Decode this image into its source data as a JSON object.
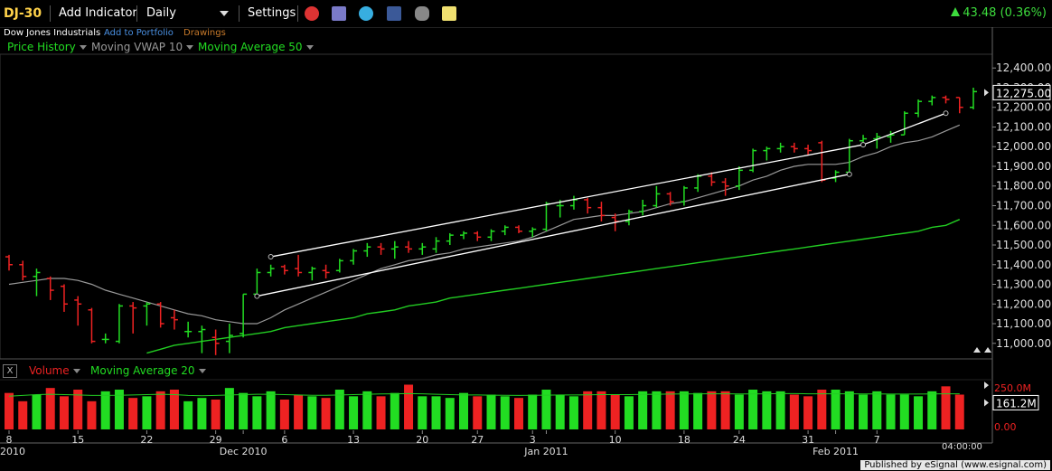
{
  "toolbar": {
    "ticker": "DJ-30",
    "add_indicator": "Add Indicator",
    "interval": "Daily",
    "settings": "Settings",
    "change": "43.48 (0.36%)"
  },
  "subbar": {
    "name": "Dow Jones Industrials",
    "add_to_portfolio": "Add to Portfolio",
    "drawings": "Drawings"
  },
  "legend": {
    "price_history": "Price History",
    "vwap": "Moving VWAP 10",
    "ma50": "Moving Average 50"
  },
  "volume_legend": {
    "close": "X",
    "volume": "Volume",
    "ma20": "Moving Average 20"
  },
  "colors": {
    "up": "#22dd22",
    "down": "#ee2222",
    "ma50": "#22cc22",
    "vwap": "#999999",
    "ticker": "#ffd24a"
  },
  "footer": "Published by eSignal (www.esignal.com)",
  "chart_data": {
    "type": "ohlc",
    "price_axis": {
      "ticks": [
        "12,400.00",
        "12,300.00",
        "12,200.00",
        "12,100.00",
        "12,000.00",
        "11,900.00",
        "11,800.00",
        "11,700.00",
        "11,600.00",
        "11,500.00",
        "11,400.00",
        "11,300.00",
        "11,200.00",
        "11,100.00",
        "11,000.00"
      ],
      "current_label": "12,275.00",
      "range": [
        10930,
        12470
      ]
    },
    "volume_axis": {
      "ticks": [
        "250.0M",
        "0.00"
      ],
      "current_label": "161.2M",
      "range": [
        0,
        300
      ]
    },
    "x_labels": [
      {
        "label": "8",
        "bar": 0
      },
      {
        "label": "15",
        "bar": 5
      },
      {
        "label": "22",
        "bar": 10
      },
      {
        "label": "29",
        "bar": 15
      },
      {
        "label": "Dec 2010",
        "bar": 17
      },
      {
        "label": "6",
        "bar": 20
      },
      {
        "label": "13",
        "bar": 25
      },
      {
        "label": "20",
        "bar": 30
      },
      {
        "label": "27",
        "bar": 34
      },
      {
        "label": "3",
        "bar": 38
      },
      {
        "label": "Jan 2011",
        "bar": 39
      },
      {
        "label": "10",
        "bar": 44
      },
      {
        "label": "18",
        "bar": 49
      },
      {
        "label": "24",
        "bar": 53
      },
      {
        "label": "31",
        "bar": 58
      },
      {
        "label": "Feb 2011",
        "bar": 60
      },
      {
        "label": "7",
        "bar": 63
      },
      {
        "label": "2010",
        "bar": 0
      }
    ],
    "time_label": "04:00:00",
    "bars": [
      {
        "o": 11440,
        "h": 11450,
        "l": 11370,
        "c": 11400
      },
      {
        "o": 11400,
        "h": 11420,
        "l": 11320,
        "c": 11340
      },
      {
        "o": 11340,
        "h": 11380,
        "l": 11240,
        "c": 11360
      },
      {
        "o": 11330,
        "h": 11340,
        "l": 11220,
        "c": 11270
      },
      {
        "o": 11290,
        "h": 11300,
        "l": 11160,
        "c": 11200
      },
      {
        "o": 11220,
        "h": 11240,
        "l": 11090,
        "c": 11200
      },
      {
        "o": 11170,
        "h": 11180,
        "l": 11000,
        "c": 11010
      },
      {
        "o": 11020,
        "h": 11050,
        "l": 11000,
        "c": 11020
      },
      {
        "o": 11010,
        "h": 11200,
        "l": 11000,
        "c": 11190
      },
      {
        "o": 11190,
        "h": 11210,
        "l": 11050,
        "c": 11180
      },
      {
        "o": 11190,
        "h": 11210,
        "l": 11090,
        "c": 11200
      },
      {
        "o": 11200,
        "h": 11210,
        "l": 11080,
        "c": 11100
      },
      {
        "o": 11130,
        "h": 11170,
        "l": 11070,
        "c": 11120
      },
      {
        "o": 11060,
        "h": 11110,
        "l": 11030,
        "c": 11060
      },
      {
        "o": 11060,
        "h": 11090,
        "l": 10950,
        "c": 11070
      },
      {
        "o": 11030,
        "h": 11070,
        "l": 10940,
        "c": 11000
      },
      {
        "o": 11010,
        "h": 11100,
        "l": 10950,
        "c": 11040
      },
      {
        "o": 11050,
        "h": 11250,
        "l": 11030,
        "c": 11250
      },
      {
        "o": 11250,
        "h": 11380,
        "l": 11240,
        "c": 11360
      },
      {
        "o": 11360,
        "h": 11400,
        "l": 11340,
        "c": 11380
      },
      {
        "o": 11390,
        "h": 11400,
        "l": 11350,
        "c": 11370
      },
      {
        "o": 11380,
        "h": 11450,
        "l": 11340,
        "c": 11360
      },
      {
        "o": 11360,
        "h": 11390,
        "l": 11320,
        "c": 11380
      },
      {
        "o": 11370,
        "h": 11400,
        "l": 11330,
        "c": 11360
      },
      {
        "o": 11370,
        "h": 11430,
        "l": 11360,
        "c": 11420
      },
      {
        "o": 11420,
        "h": 11480,
        "l": 11400,
        "c": 11470
      },
      {
        "o": 11470,
        "h": 11510,
        "l": 11440,
        "c": 11490
      },
      {
        "o": 11490,
        "h": 11510,
        "l": 11450,
        "c": 11480
      },
      {
        "o": 11480,
        "h": 11520,
        "l": 11430,
        "c": 11490
      },
      {
        "o": 11490,
        "h": 11520,
        "l": 11460,
        "c": 11480
      },
      {
        "o": 11480,
        "h": 11510,
        "l": 11450,
        "c": 11490
      },
      {
        "o": 11480,
        "h": 11540,
        "l": 11460,
        "c": 11520
      },
      {
        "o": 11520,
        "h": 11560,
        "l": 11500,
        "c": 11550
      },
      {
        "o": 11550,
        "h": 11570,
        "l": 11530,
        "c": 11560
      },
      {
        "o": 11560,
        "h": 11570,
        "l": 11520,
        "c": 11540
      },
      {
        "o": 11540,
        "h": 11580,
        "l": 11520,
        "c": 11570
      },
      {
        "o": 11570,
        "h": 11600,
        "l": 11550,
        "c": 11590
      },
      {
        "o": 11590,
        "h": 11600,
        "l": 11560,
        "c": 11570
      },
      {
        "o": 11570,
        "h": 11590,
        "l": 11540,
        "c": 11580
      },
      {
        "o": 11580,
        "h": 11720,
        "l": 11570,
        "c": 11710
      },
      {
        "o": 11700,
        "h": 11730,
        "l": 11640,
        "c": 11700
      },
      {
        "o": 11700,
        "h": 11750,
        "l": 11680,
        "c": 11730
      },
      {
        "o": 11730,
        "h": 11740,
        "l": 11660,
        "c": 11690
      },
      {
        "o": 11690,
        "h": 11720,
        "l": 11620,
        "c": 11650
      },
      {
        "o": 11640,
        "h": 11660,
        "l": 11570,
        "c": 11620
      },
      {
        "o": 11620,
        "h": 11680,
        "l": 11600,
        "c": 11670
      },
      {
        "o": 11670,
        "h": 11730,
        "l": 11650,
        "c": 11700
      },
      {
        "o": 11700,
        "h": 11800,
        "l": 11690,
        "c": 11760
      },
      {
        "o": 11760,
        "h": 11770,
        "l": 11700,
        "c": 11720
      },
      {
        "o": 11720,
        "h": 11800,
        "l": 11700,
        "c": 11790
      },
      {
        "o": 11790,
        "h": 11860,
        "l": 11770,
        "c": 11850
      },
      {
        "o": 11850,
        "h": 11870,
        "l": 11800,
        "c": 11820
      },
      {
        "o": 11820,
        "h": 11840,
        "l": 11750,
        "c": 11800
      },
      {
        "o": 11800,
        "h": 11900,
        "l": 11780,
        "c": 11880
      },
      {
        "o": 11880,
        "h": 11990,
        "l": 11870,
        "c": 11980
      },
      {
        "o": 11980,
        "h": 12000,
        "l": 11930,
        "c": 11990
      },
      {
        "o": 11990,
        "h": 12020,
        "l": 11970,
        "c": 12000
      },
      {
        "o": 12000,
        "h": 12020,
        "l": 11970,
        "c": 11990
      },
      {
        "o": 11990,
        "h": 12010,
        "l": 11960,
        "c": 11980
      },
      {
        "o": 12020,
        "h": 12030,
        "l": 11820,
        "c": 11830
      },
      {
        "o": 11840,
        "h": 11880,
        "l": 11820,
        "c": 11870
      },
      {
        "o": 11870,
        "h": 12040,
        "l": 11860,
        "c": 12030
      },
      {
        "o": 12030,
        "h": 12060,
        "l": 12000,
        "c": 12040
      },
      {
        "o": 12040,
        "h": 12070,
        "l": 11990,
        "c": 12050
      },
      {
        "o": 12050,
        "h": 12080,
        "l": 12020,
        "c": 12060
      },
      {
        "o": 12060,
        "h": 12180,
        "l": 12060,
        "c": 12170
      },
      {
        "o": 12170,
        "h": 12240,
        "l": 12150,
        "c": 12230
      },
      {
        "o": 12230,
        "h": 12260,
        "l": 12210,
        "c": 12250
      },
      {
        "o": 12250,
        "h": 12260,
        "l": 12220,
        "c": 12240
      },
      {
        "o": 12250,
        "h": 12250,
        "l": 12170,
        "c": 12200
      },
      {
        "o": 12200,
        "h": 12300,
        "l": 12190,
        "c": 12280
      }
    ],
    "vwap10": [
      11300,
      11310,
      11320,
      11330,
      11330,
      11320,
      11300,
      11270,
      11250,
      11230,
      11210,
      11190,
      11170,
      11150,
      11140,
      11120,
      11110,
      11100,
      11100,
      11130,
      11170,
      11200,
      11230,
      11260,
      11290,
      11320,
      11350,
      11380,
      11400,
      11420,
      11430,
      11450,
      11460,
      11480,
      11490,
      11500,
      11510,
      11520,
      11540,
      11570,
      11600,
      11630,
      11640,
      11650,
      11650,
      11660,
      11670,
      11690,
      11710,
      11720,
      11740,
      11760,
      11780,
      11800,
      11830,
      11850,
      11880,
      11900,
      11910,
      11910,
      11910,
      11920,
      11950,
      11970,
      12000,
      12020,
      12030,
      12050,
      12080,
      12110
    ],
    "ma50": [
      null,
      null,
      null,
      null,
      null,
      null,
      null,
      null,
      null,
      null,
      10950,
      10970,
      10990,
      11000,
      11010,
      11020,
      11030,
      11040,
      11050,
      11060,
      11080,
      11090,
      11100,
      11110,
      11120,
      11130,
      11150,
      11160,
      11170,
      11190,
      11200,
      11210,
      11230,
      11240,
      11250,
      11260,
      11270,
      11280,
      11290,
      11300,
      11310,
      11320,
      11330,
      11340,
      11350,
      11360,
      11370,
      11380,
      11390,
      11400,
      11410,
      11420,
      11430,
      11440,
      11450,
      11460,
      11470,
      11480,
      11490,
      11500,
      11510,
      11520,
      11530,
      11540,
      11550,
      11560,
      11570,
      11590,
      11600,
      11630
    ],
    "trendlines": [
      {
        "from": [
          19,
          11440
        ],
        "to": [
          62,
          12010
        ]
      },
      {
        "from": [
          18,
          11240
        ],
        "to": [
          61,
          11860
        ]
      },
      {
        "from": [
          62,
          12010
        ],
        "to": [
          68,
          12170
        ]
      }
    ],
    "volume": [
      220,
      170,
      210,
      250,
      200,
      240,
      170,
      230,
      240,
      190,
      200,
      230,
      240,
      170,
      190,
      180,
      250,
      220,
      200,
      230,
      180,
      210,
      200,
      190,
      240,
      200,
      230,
      200,
      220,
      270,
      200,
      200,
      190,
      220,
      200,
      210,
      200,
      190,
      210,
      240,
      210,
      200,
      230,
      230,
      210,
      200,
      230,
      230,
      230,
      230,
      220,
      230,
      230,
      210,
      240,
      230,
      230,
      210,
      200,
      240,
      240,
      230,
      210,
      230,
      210,
      210,
      200,
      230,
      260,
      210
    ],
    "vol_ma20": [
      200,
      205,
      210,
      212,
      210,
      208,
      205,
      205,
      206,
      208,
      210,
      212,
      210,
      205,
      203,
      205,
      208,
      210,
      212,
      212,
      210,
      208,
      206,
      206,
      208,
      210,
      212,
      214,
      215,
      216,
      215,
      212,
      210,
      208,
      208,
      207,
      206,
      205,
      206,
      207,
      208,
      208,
      209,
      210,
      210,
      210,
      211,
      212,
      213,
      214,
      215,
      215,
      215,
      214,
      214,
      215,
      216,
      216,
      215,
      215,
      215,
      215,
      214,
      214,
      213,
      213,
      213,
      214,
      215,
      215
    ]
  }
}
